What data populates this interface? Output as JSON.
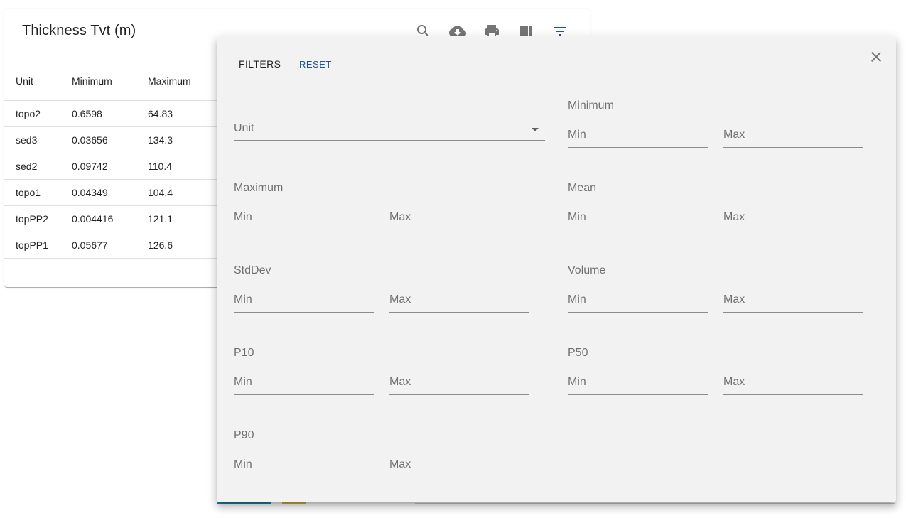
{
  "table": {
    "title": "Thickness Tvt (m)",
    "columns": [
      "Unit",
      "Minimum",
      "Maximum"
    ],
    "rows": [
      [
        "topo2",
        "0.6598",
        "64.83"
      ],
      [
        "sed3",
        "0.03656",
        "134.3"
      ],
      [
        "sed2",
        "0.09742",
        "110.4"
      ],
      [
        "topo1",
        "0.04349",
        "104.4"
      ],
      [
        "topPP2",
        "0.004416",
        "121.1"
      ],
      [
        "topPP1",
        "0.05677",
        "126.6"
      ]
    ]
  },
  "toolbar": {
    "icons": [
      "search-icon",
      "cloud-download-icon",
      "print-icon",
      "view-column-icon",
      "filter-list-icon"
    ],
    "active_color": "#1f5596",
    "icon_color": "#757575"
  },
  "filters": {
    "title": "FILTERS",
    "reset_label": "RESET",
    "close_icon": "close-icon",
    "unit_select": {
      "label": "Unit"
    },
    "min_placeholder": "Min",
    "max_placeholder": "Max",
    "groups": [
      {
        "label": "Minimum"
      },
      {
        "label": "Maximum"
      },
      {
        "label": "Mean"
      },
      {
        "label": "StdDev"
      },
      {
        "label": "Volume"
      },
      {
        "label": "P10"
      },
      {
        "label": "P50"
      },
      {
        "label": "P90"
      }
    ]
  }
}
